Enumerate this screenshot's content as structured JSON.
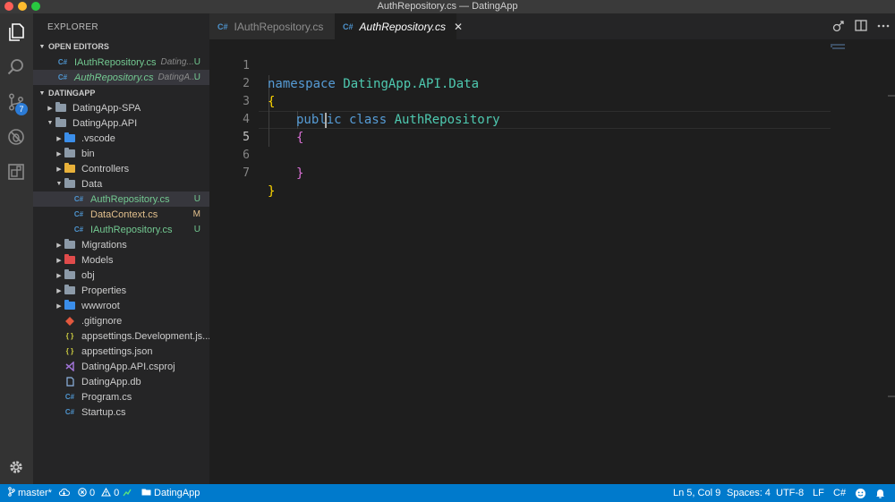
{
  "window": {
    "title": "AuthRepository.cs — DatingApp"
  },
  "activity_bar": {
    "scm_badge": "7"
  },
  "sidebar": {
    "title": "EXPLORER",
    "open_editors_header": "OPEN EDITORS",
    "open_editors": [
      {
        "name": "IAuthRepository.cs",
        "desc": "Dating...",
        "mark": "U"
      },
      {
        "name": "AuthRepository.cs",
        "desc": "DatingA...",
        "mark": "U"
      }
    ],
    "project_header": "DATINGAPP",
    "tree": [
      {
        "name": "DatingApp-SPA"
      },
      {
        "name": "DatingApp.API"
      },
      {
        "name": ".vscode"
      },
      {
        "name": "bin"
      },
      {
        "name": "Controllers"
      },
      {
        "name": "Data"
      },
      {
        "name": "AuthRepository.cs",
        "mark": "U"
      },
      {
        "name": "DataContext.cs",
        "mark": "M"
      },
      {
        "name": "IAuthRepository.cs",
        "mark": "U"
      },
      {
        "name": "Migrations"
      },
      {
        "name": "Models"
      },
      {
        "name": "obj"
      },
      {
        "name": "Properties"
      },
      {
        "name": "wwwroot"
      },
      {
        "name": ".gitignore"
      },
      {
        "name": "appsettings.Development.js..."
      },
      {
        "name": "appsettings.json"
      },
      {
        "name": "DatingApp.API.csproj"
      },
      {
        "name": "DatingApp.db"
      },
      {
        "name": "Program.cs"
      },
      {
        "name": "Startup.cs"
      }
    ]
  },
  "tabs": [
    {
      "label": "IAuthRepository.cs",
      "icon": "C#"
    },
    {
      "label": "AuthRepository.cs",
      "icon": "C#",
      "close": "✕"
    }
  ],
  "editor": {
    "line_numbers": [
      "1",
      "2",
      "3",
      "4",
      "5",
      "6",
      "7"
    ],
    "tokens": {
      "l1_kw": "namespace ",
      "l1_ns": "DatingApp.API.Data",
      "l2": "{",
      "l3_kw": "public class ",
      "l3_cls": "AuthRepository",
      "l4": "{",
      "l6": "}",
      "l7": "}"
    }
  },
  "statusbar": {
    "branch": "master*",
    "errors": "0",
    "warnings": "0",
    "folder": "DatingApp",
    "position": "Ln 5, Col 9",
    "spaces": "Spaces: 4",
    "encoding": "UTF-8",
    "eol": "LF",
    "language": "C#"
  },
  "colors": {
    "accent": "#007acc",
    "untracked": "#73c991",
    "modified": "#e2c08d"
  }
}
